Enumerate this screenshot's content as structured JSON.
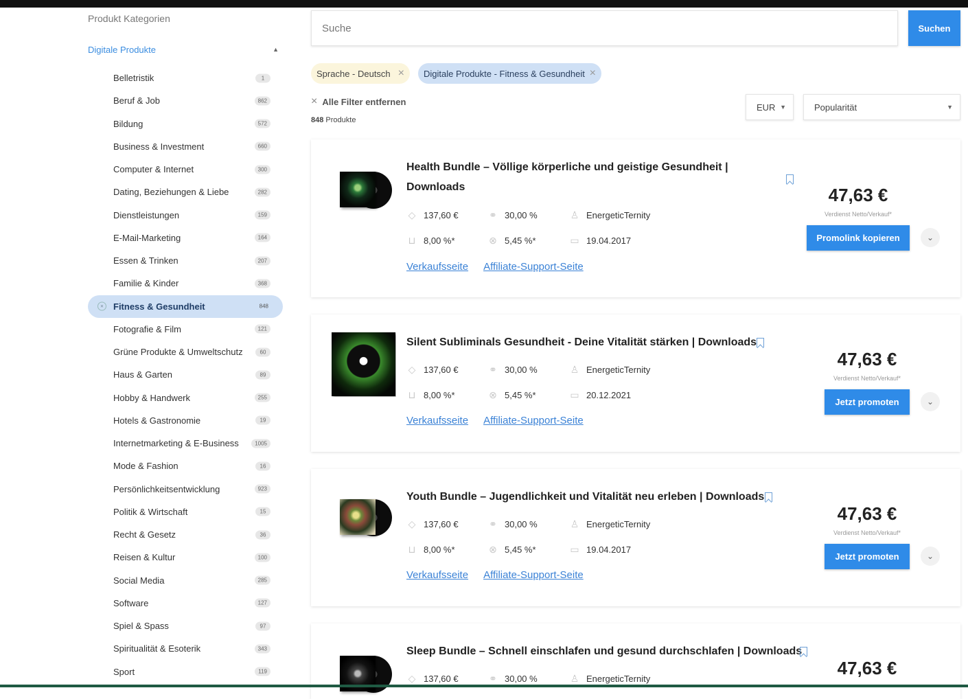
{
  "sidebar": {
    "title": "Produkt Kategorien",
    "group": "Digitale Produkte",
    "categories": [
      {
        "label": "Belletristik",
        "count": "1"
      },
      {
        "label": "Beruf & Job",
        "count": "862"
      },
      {
        "label": "Bildung",
        "count": "572"
      },
      {
        "label": "Business & Investment",
        "count": "660"
      },
      {
        "label": "Computer & Internet",
        "count": "300"
      },
      {
        "label": "Dating, Beziehungen & Liebe",
        "count": "282"
      },
      {
        "label": "Dienstleistungen",
        "count": "159"
      },
      {
        "label": "E-Mail-Marketing",
        "count": "164"
      },
      {
        "label": "Essen & Trinken",
        "count": "207"
      },
      {
        "label": "Familie & Kinder",
        "count": "368"
      },
      {
        "label": "Fitness & Gesundheit",
        "count": "848",
        "active": true
      },
      {
        "label": "Fotografie & Film",
        "count": "121"
      },
      {
        "label": "Grüne Produkte & Umweltschutz",
        "count": "60"
      },
      {
        "label": "Haus & Garten",
        "count": "89"
      },
      {
        "label": "Hobby & Handwerk",
        "count": "255"
      },
      {
        "label": "Hotels & Gastronomie",
        "count": "19"
      },
      {
        "label": "Internetmarketing & E-Business",
        "count": "1005"
      },
      {
        "label": "Mode & Fashion",
        "count": "16"
      },
      {
        "label": "Persönlichkeitsentwicklung",
        "count": "923"
      },
      {
        "label": "Politik & Wirtschaft",
        "count": "15"
      },
      {
        "label": "Recht & Gesetz",
        "count": "36"
      },
      {
        "label": "Reisen & Kultur",
        "count": "100"
      },
      {
        "label": "Social Media",
        "count": "285"
      },
      {
        "label": "Software",
        "count": "127"
      },
      {
        "label": "Spiel & Spass",
        "count": "97"
      },
      {
        "label": "Spiritualität & Esoterik",
        "count": "343"
      },
      {
        "label": "Sport",
        "count": "119"
      }
    ]
  },
  "search": {
    "placeholder": "Suche",
    "button": "Suchen"
  },
  "filters": {
    "chips": [
      "Sprache - Deutsch",
      "Digitale Produkte - Fitness & Gesundheit"
    ],
    "clear_all": "Alle Filter entfernen",
    "count_number": "848",
    "count_label": "Produkte",
    "currency": "EUR",
    "sort": "Popularität"
  },
  "products": [
    {
      "title_line1": "Health Bundle – Völlige körperliche und geistige Gesundheit |",
      "title_line2": "Downloads",
      "price_ref": "137,60 €",
      "commission": "30,00 %",
      "vendor": "EnergeticTernity",
      "cart_rate": "8,00 %*",
      "cancel_rate": "5,45 %*",
      "date": "19.04.2017",
      "link_sales": "Verkaufsseite",
      "link_support": "Affiliate-Support-Seite",
      "price": "47,63 €",
      "price_note": "Verdienst Netto/Verkauf*",
      "cta": "Promolink kopieren"
    },
    {
      "title_line1": "Silent Subliminals Gesundheit - Deine Vitalität stärken | Downloads",
      "price_ref": "137,60 €",
      "commission": "30,00 %",
      "vendor": "EnergeticTernity",
      "cart_rate": "8,00 %*",
      "cancel_rate": "5,45 %*",
      "date": "20.12.2021",
      "link_sales": "Verkaufsseite",
      "link_support": "Affiliate-Support-Seite",
      "price": "47,63 €",
      "price_note": "Verdienst Netto/Verkauf*",
      "cta": "Jetzt promoten"
    },
    {
      "title_line1": "Youth Bundle – Jugendlichkeit und Vitalität neu erleben | Downloads",
      "price_ref": "137,60 €",
      "commission": "30,00 %",
      "vendor": "EnergeticTernity",
      "cart_rate": "8,00 %*",
      "cancel_rate": "5,45 %*",
      "date": "19.04.2017",
      "link_sales": "Verkaufsseite",
      "link_support": "Affiliate-Support-Seite",
      "price": "47,63 €",
      "price_note": "Verdienst Netto/Verkauf*",
      "cta": "Jetzt promoten"
    },
    {
      "title_line1": "Sleep Bundle – Schnell einschlafen und gesund durchschlafen | Downloads",
      "price_ref": "137,60 €",
      "commission": "30,00 %",
      "vendor": "EnergeticTernity",
      "price": "47,63 €"
    }
  ],
  "colors": {
    "accent": "#2f8be8",
    "active_category_bg": "#cfe0f5",
    "language_chip_bg": "#fbf5dc",
    "link": "#3b82d6"
  }
}
